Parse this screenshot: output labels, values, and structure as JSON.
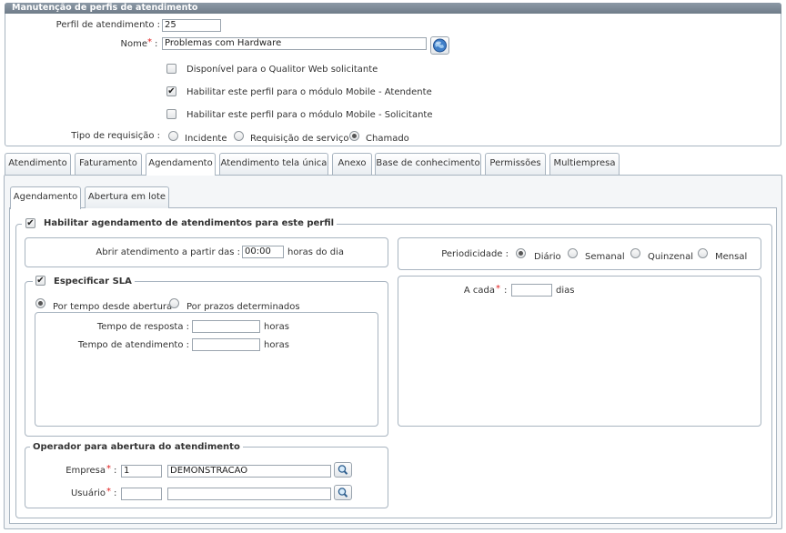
{
  "window": {
    "title": "Manutenção de perfis de atendimento"
  },
  "form": {
    "perfil_label": "Perfil de atendimento :",
    "perfil_value": "25",
    "nome_label": "Nome",
    "nome_value": "Problemas com Hardware",
    "colon": ":",
    "req_mark": "*",
    "opt_web": "Disponível para o Qualitor Web solicitante",
    "opt_web_checked": false,
    "opt_mobile_atendente": "Habilitar este perfil para o módulo Mobile - Atendente",
    "opt_mobile_atendente_checked": true,
    "opt_mobile_solicitante": "Habilitar este perfil para o módulo Mobile - Solicitante",
    "opt_mobile_solicitante_checked": false,
    "tipo_label": "Tipo de requisição :",
    "tipo_options": [
      "Incidente",
      "Requisição de serviço",
      "Chamado"
    ],
    "tipo_selected": "Chamado"
  },
  "tabs": [
    "Atendimento",
    "Faturamento",
    "Agendamento",
    "Atendimento tela única",
    "Anexo",
    "Base de conhecimento",
    "Permissões",
    "Multiempresa"
  ],
  "active_tab": "Agendamento",
  "subtabs": [
    "Agendamento",
    "Abertura em lote"
  ],
  "active_subtab": "Agendamento",
  "agendamento": {
    "enable_label": "Habilitar agendamento de atendimentos para este perfil",
    "enable_checked": true,
    "abrir_label": "Abrir atendimento a partir das :",
    "abrir_value": "00:00",
    "abrir_suffix": "horas do dia",
    "period_label": "Periodicidade :",
    "period_options": [
      "Diário",
      "Semanal",
      "Quinzenal",
      "Mensal"
    ],
    "period_selected": "Diário",
    "acada_label": "A cada",
    "acada_value": "",
    "acada_suffix": "dias",
    "sla_label": "Especificar SLA",
    "sla_checked": true,
    "sla_options": [
      "Por tempo desde abertura",
      "Por prazos determinados"
    ],
    "sla_selected": "Por tempo desde abertura",
    "resp_label": "Tempo de resposta :",
    "resp_value": "",
    "atend_label": "Tempo de atendimento :",
    "atend_value": "",
    "horas": "horas",
    "operador_label": "Operador para abertura do atendimento",
    "empresa_label": "Empresa",
    "empresa_code": "1",
    "empresa_name": "DEMONSTRACAO",
    "usuario_label": "Usuário",
    "usuario_code": "",
    "usuario_name": ""
  }
}
